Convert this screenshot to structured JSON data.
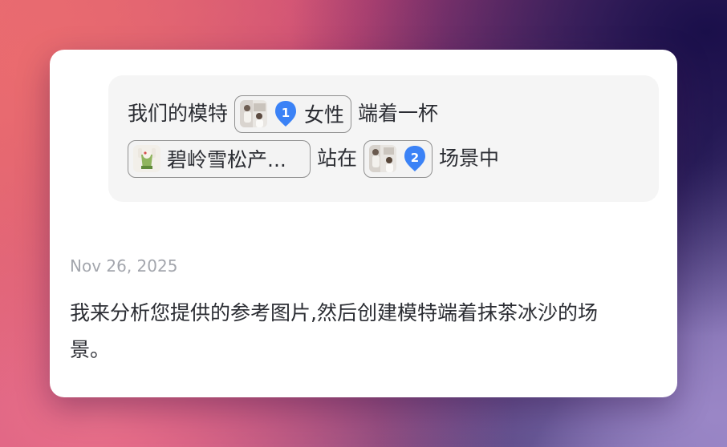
{
  "colors": {
    "pin_blue": "#3b82f6",
    "bubble_bg": "#f5f5f5",
    "date_gray": "#a3a6ad",
    "text_dark": "#2b2d33"
  },
  "user_message": {
    "line1": {
      "text_a": "我们的模特",
      "chip": {
        "thumb_icon": "model-photo-thumbnail",
        "pin_number": "1",
        "label": "女性"
      },
      "text_b": "端着一杯"
    },
    "line2": {
      "product_chip": {
        "thumb_icon": "product-photo-thumbnail",
        "label": "碧岭雪松产..."
      },
      "text_a": "站在",
      "chip": {
        "thumb_icon": "scene-photo-thumbnail",
        "pin_number": "2"
      },
      "text_b": "场景中"
    }
  },
  "assistant_message": {
    "date": "Nov 26, 2025",
    "text": "我来分析您提供的参考图片,然后创建模特端着抹茶冰沙的场景。"
  }
}
